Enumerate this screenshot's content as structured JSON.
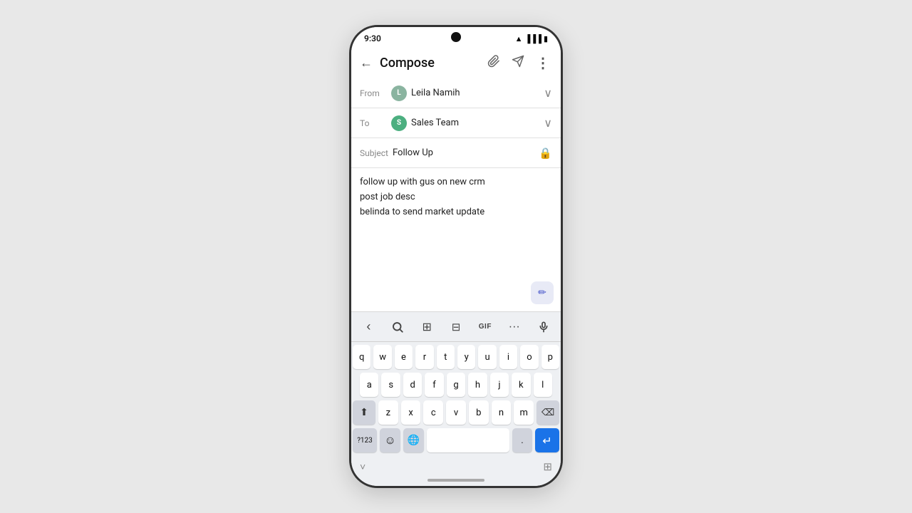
{
  "status_bar": {
    "time": "9:30"
  },
  "app_bar": {
    "title": "Compose",
    "back_label": "←",
    "attach_icon": "📎",
    "send_icon": "▷",
    "more_icon": "⋮"
  },
  "email": {
    "from_label": "From",
    "from_name": "Leila Namih",
    "from_avatar_letter": "L",
    "to_label": "To",
    "to_name": "Sales Team",
    "to_avatar_letter": "S",
    "subject_label": "Subject",
    "subject_value": "Follow Up",
    "body_line1": "follow up with gus on new crm",
    "body_line2": "post job desc",
    "body_line3": "belinda to send market update"
  },
  "keyboard_toolbar": {
    "back": "‹",
    "search": "🔍",
    "translate": "⊞",
    "clipboard": "⊟",
    "gif": "GIF",
    "more": "···",
    "mic": "🎙"
  },
  "keyboard": {
    "row1": [
      "q",
      "w",
      "e",
      "r",
      "t",
      "y",
      "u",
      "i",
      "o",
      "p"
    ],
    "row2": [
      "a",
      "s",
      "d",
      "f",
      "g",
      "h",
      "j",
      "k",
      "l"
    ],
    "row3": [
      "z",
      "x",
      "c",
      "v",
      "b",
      "n",
      "m"
    ],
    "bottom": {
      "num": "?123",
      "emoji": "☺",
      "globe": "🌐",
      "space": "",
      "period": ".",
      "enter": "↵"
    }
  },
  "bottom_bar": {
    "chevron": "˅",
    "grid": "⊞"
  }
}
